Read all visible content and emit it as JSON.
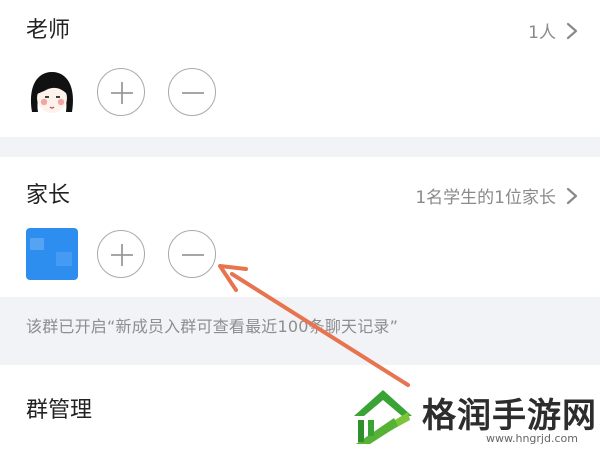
{
  "teacher_section": {
    "title": "老师",
    "count": "1人",
    "avatar_icon": "teacher-avatar-icon",
    "add_icon": "plus-icon",
    "remove_icon": "minus-icon"
  },
  "parent_section": {
    "title": "家长",
    "summary": "1名学生的1位家长",
    "avatar_icon": "parent-avatar-icon",
    "avatar_color": "#2e8ef0",
    "add_icon": "plus-icon",
    "remove_icon": "minus-icon"
  },
  "notice": {
    "text": "该群已开启“新成员入群可查看最近100条聊天记录”"
  },
  "group_manage": {
    "title": "群管理"
  },
  "annotation": {
    "arrow_color": "#e8734f"
  },
  "watermark": {
    "text": "格润手游网",
    "url": "www.hngrjd.com"
  }
}
